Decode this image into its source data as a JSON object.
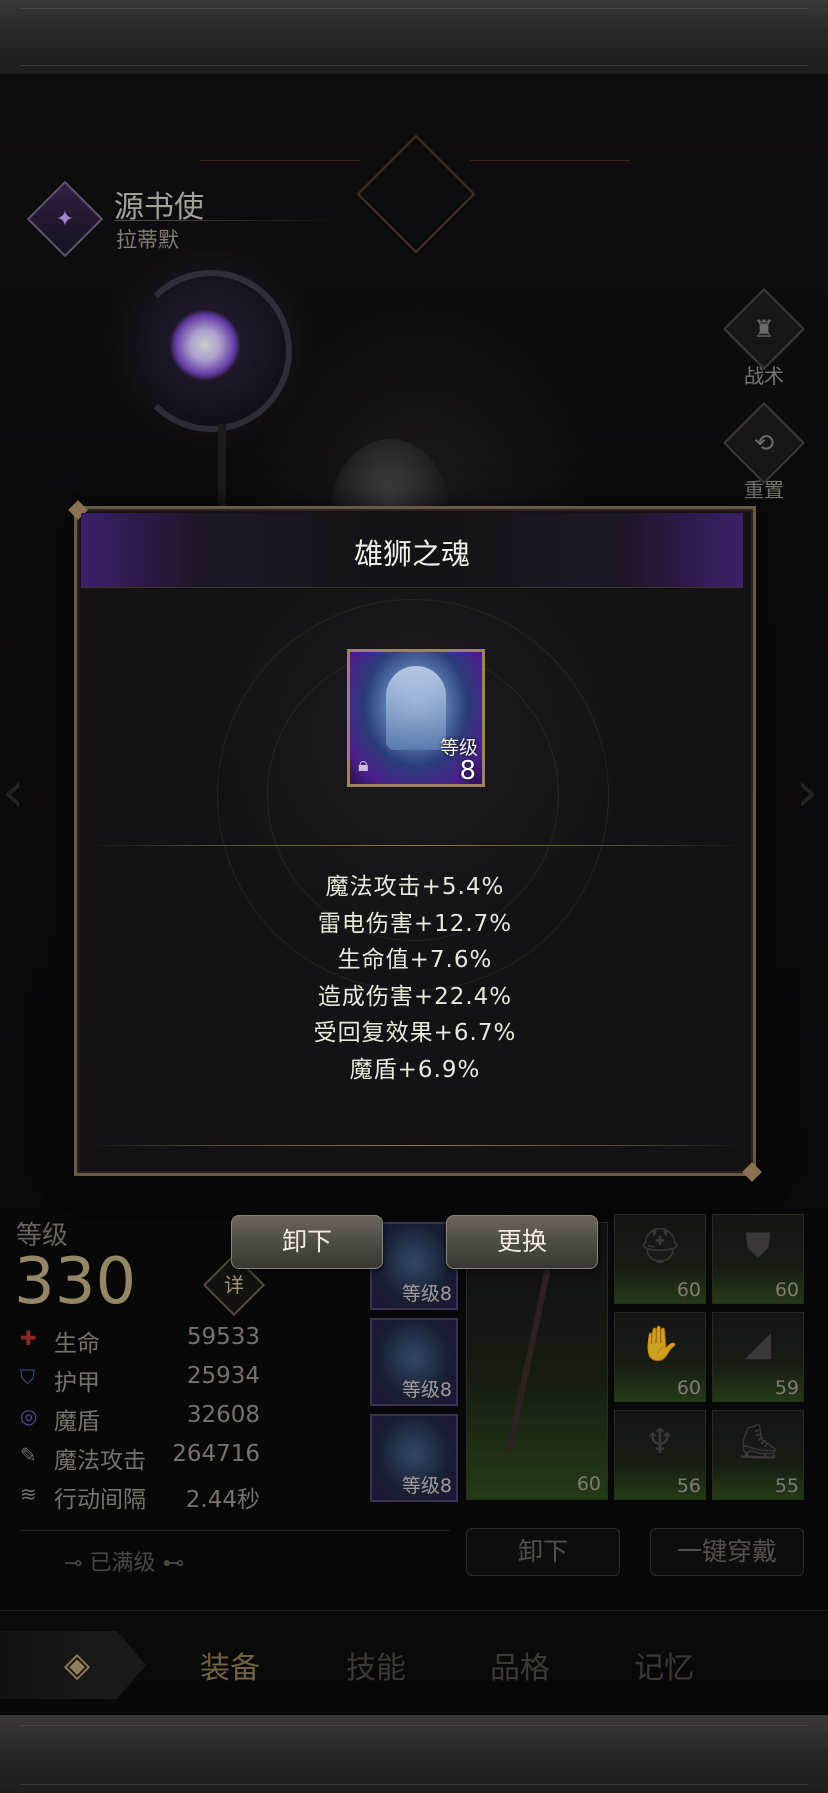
{
  "hero": {
    "class_name": "源书使",
    "name": "拉蒂默"
  },
  "side_buttons": [
    {
      "label": "战术",
      "icon": "tactics-icon"
    },
    {
      "label": "重置",
      "icon": "reset-icon"
    }
  ],
  "modal": {
    "title": "雄狮之魂",
    "item": {
      "level_label": "等级",
      "level_value": "8",
      "locked": true
    },
    "attributes": [
      "魔法攻击+5.4%",
      "雷电伤害+12.7%",
      "生命值+7.6%",
      "造成伤害+22.4%",
      "受回复效果+6.7%",
      "魔盾+6.9%"
    ],
    "buttons": {
      "unequip": "卸下",
      "replace": "更换"
    }
  },
  "stats": {
    "level_label": "等级",
    "level_value": "330",
    "detail_label": "详",
    "rows": [
      {
        "name": "生命",
        "value": "59533",
        "icon": "health-icon",
        "color": "#b0302c"
      },
      {
        "name": "护甲",
        "value": "25934",
        "icon": "armor-icon",
        "color": "#4a6aa8"
      },
      {
        "name": "魔盾",
        "value": "32608",
        "icon": "magic-shield-icon",
        "color": "#7a56b8"
      },
      {
        "name": "魔法攻击",
        "value": "264716",
        "icon": "magic-attack-icon",
        "color": "#8a8a8a"
      },
      {
        "name": "行动间隔",
        "value": "2.44秒",
        "icon": "action-interval-icon",
        "color": "#8a8a8a"
      }
    ],
    "maxed_label": "已满级"
  },
  "rune_slots": [
    {
      "level": "等级8"
    },
    {
      "level": "等级8"
    },
    {
      "level": "等级8"
    }
  ],
  "weapon": {
    "level": "60"
  },
  "gear_slots": [
    {
      "level": "60",
      "icon": "helmet-icon"
    },
    {
      "level": "60",
      "icon": "chest-armor-icon"
    },
    {
      "level": "60",
      "icon": "gloves-icon"
    },
    {
      "level": "59",
      "icon": "shoulder-icon"
    },
    {
      "level": "56",
      "icon": "amulet-icon"
    },
    {
      "level": "55",
      "icon": "boots-icon"
    }
  ],
  "bottom_buttons": {
    "unequip_all": "卸下",
    "equip_all": "一键穿戴"
  },
  "tabs": [
    {
      "label": "装备",
      "active": true
    },
    {
      "label": "技能",
      "active": false
    },
    {
      "label": "品格",
      "active": false
    },
    {
      "label": "记忆",
      "active": false
    }
  ],
  "colors": {
    "accent_gold": "#b9a880",
    "modal_border": "#6b5a43",
    "rare_purple": "#4b1f8a"
  }
}
